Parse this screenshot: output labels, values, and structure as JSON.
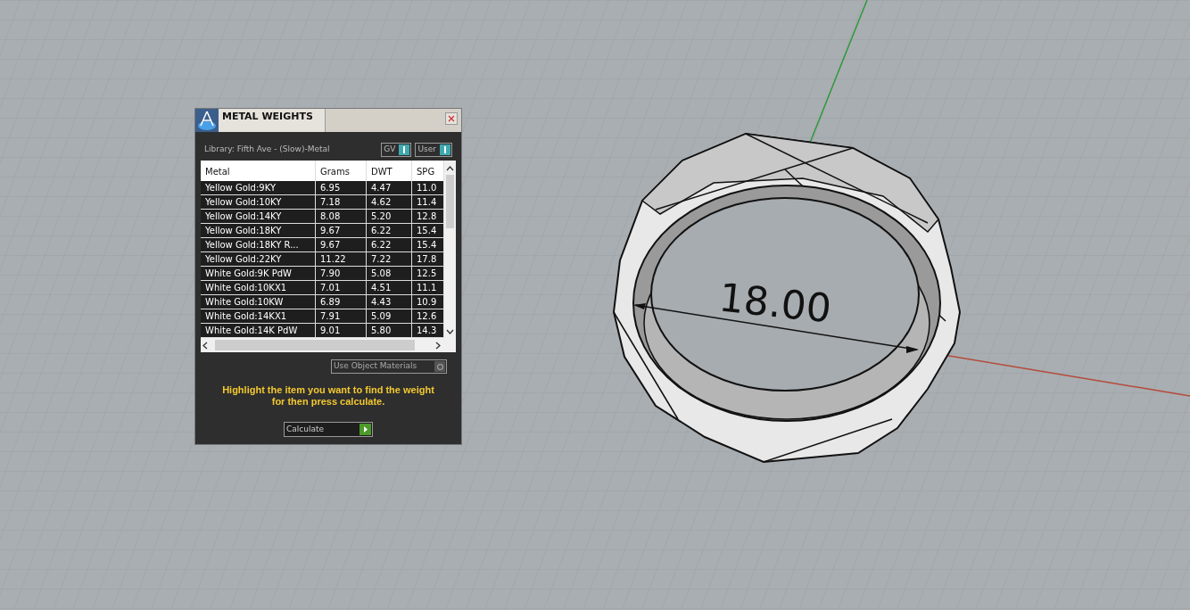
{
  "viewport": {
    "dimension": "18.00"
  },
  "dialog": {
    "title": "METAL WEIGHTS",
    "library": "Library: Fifth Ave - (Slow)-Metal",
    "toggles": [
      {
        "label": "GV",
        "on": true
      },
      {
        "label": "User",
        "on": true
      }
    ],
    "table": {
      "columns": [
        "Metal",
        "Grams",
        "DWT",
        "SPG"
      ],
      "rows": [
        [
          "Yellow Gold:9KY",
          "6.95",
          "4.47",
          "11.0"
        ],
        [
          "Yellow Gold:10KY",
          "7.18",
          "4.62",
          "11.4"
        ],
        [
          "Yellow Gold:14KY",
          "8.08",
          "5.20",
          "12.8"
        ],
        [
          "Yellow Gold:18KY",
          "9.67",
          "6.22",
          "15.4"
        ],
        [
          "Yellow Gold:18KY R...",
          "9.67",
          "6.22",
          "15.4"
        ],
        [
          "Yellow Gold:22KY",
          "11.22",
          "7.22",
          "17.8"
        ],
        [
          "White Gold:9K PdW",
          "7.90",
          "5.08",
          "12.5"
        ],
        [
          "White Gold:10KX1",
          "7.01",
          "4.51",
          "11.1"
        ],
        [
          "White Gold:10KW",
          "6.89",
          "4.43",
          "10.9"
        ],
        [
          "White Gold:14KX1",
          "7.91",
          "5.09",
          "12.6"
        ],
        [
          "White Gold:14K PdW",
          "9.01",
          "5.80",
          "14.3"
        ]
      ]
    },
    "use_object_materials": {
      "label": "Use Object Materials",
      "on": false
    },
    "hint": "Highlight the item you want to find the weight for then press calculate.",
    "calculate_button": "Calculate"
  }
}
